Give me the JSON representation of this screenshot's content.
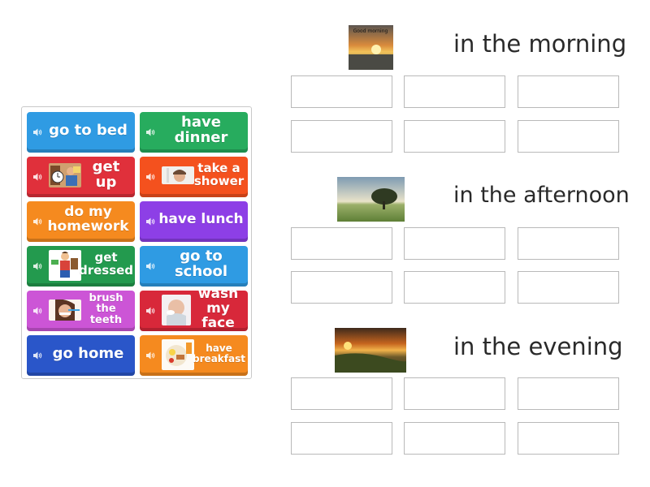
{
  "tiles": [
    {
      "label_l1": "go to bed",
      "label_l2": ""
    },
    {
      "label_l1": "have",
      "label_l2": "dinner"
    },
    {
      "label_l1": "get up",
      "label_l2": ""
    },
    {
      "label_l1": "take a",
      "label_l2": "shower"
    },
    {
      "label_l1": "do my",
      "label_l2": "homework"
    },
    {
      "label_l1": "have lunch",
      "label_l2": ""
    },
    {
      "label_l1": "get",
      "label_l2": "dressed"
    },
    {
      "label_l1": "go to",
      "label_l2": "school"
    },
    {
      "label_l1": "brush",
      "label_l2": "the teeth"
    },
    {
      "label_l1": "wash",
      "label_l2": "my face"
    },
    {
      "label_l1": "go home",
      "label_l2": ""
    },
    {
      "label_l1": "have",
      "label_l2": "breakfast"
    }
  ],
  "groups": [
    {
      "title": "in the morning",
      "image_caption": "Good morning"
    },
    {
      "title": "in the afternoon"
    },
    {
      "title": "in the evening"
    }
  ],
  "colors": {
    "blue": "#2f9be3",
    "green": "#27ac5e",
    "red": "#e0303b",
    "orangered": "#f4511e",
    "orange": "#f58a1f",
    "purple": "#8d3fe6",
    "magenta": "#cc55d6",
    "crimson": "#d8283a",
    "navy": "#2a56c9"
  },
  "icons": {
    "tile_audio": "speaker-icon"
  }
}
